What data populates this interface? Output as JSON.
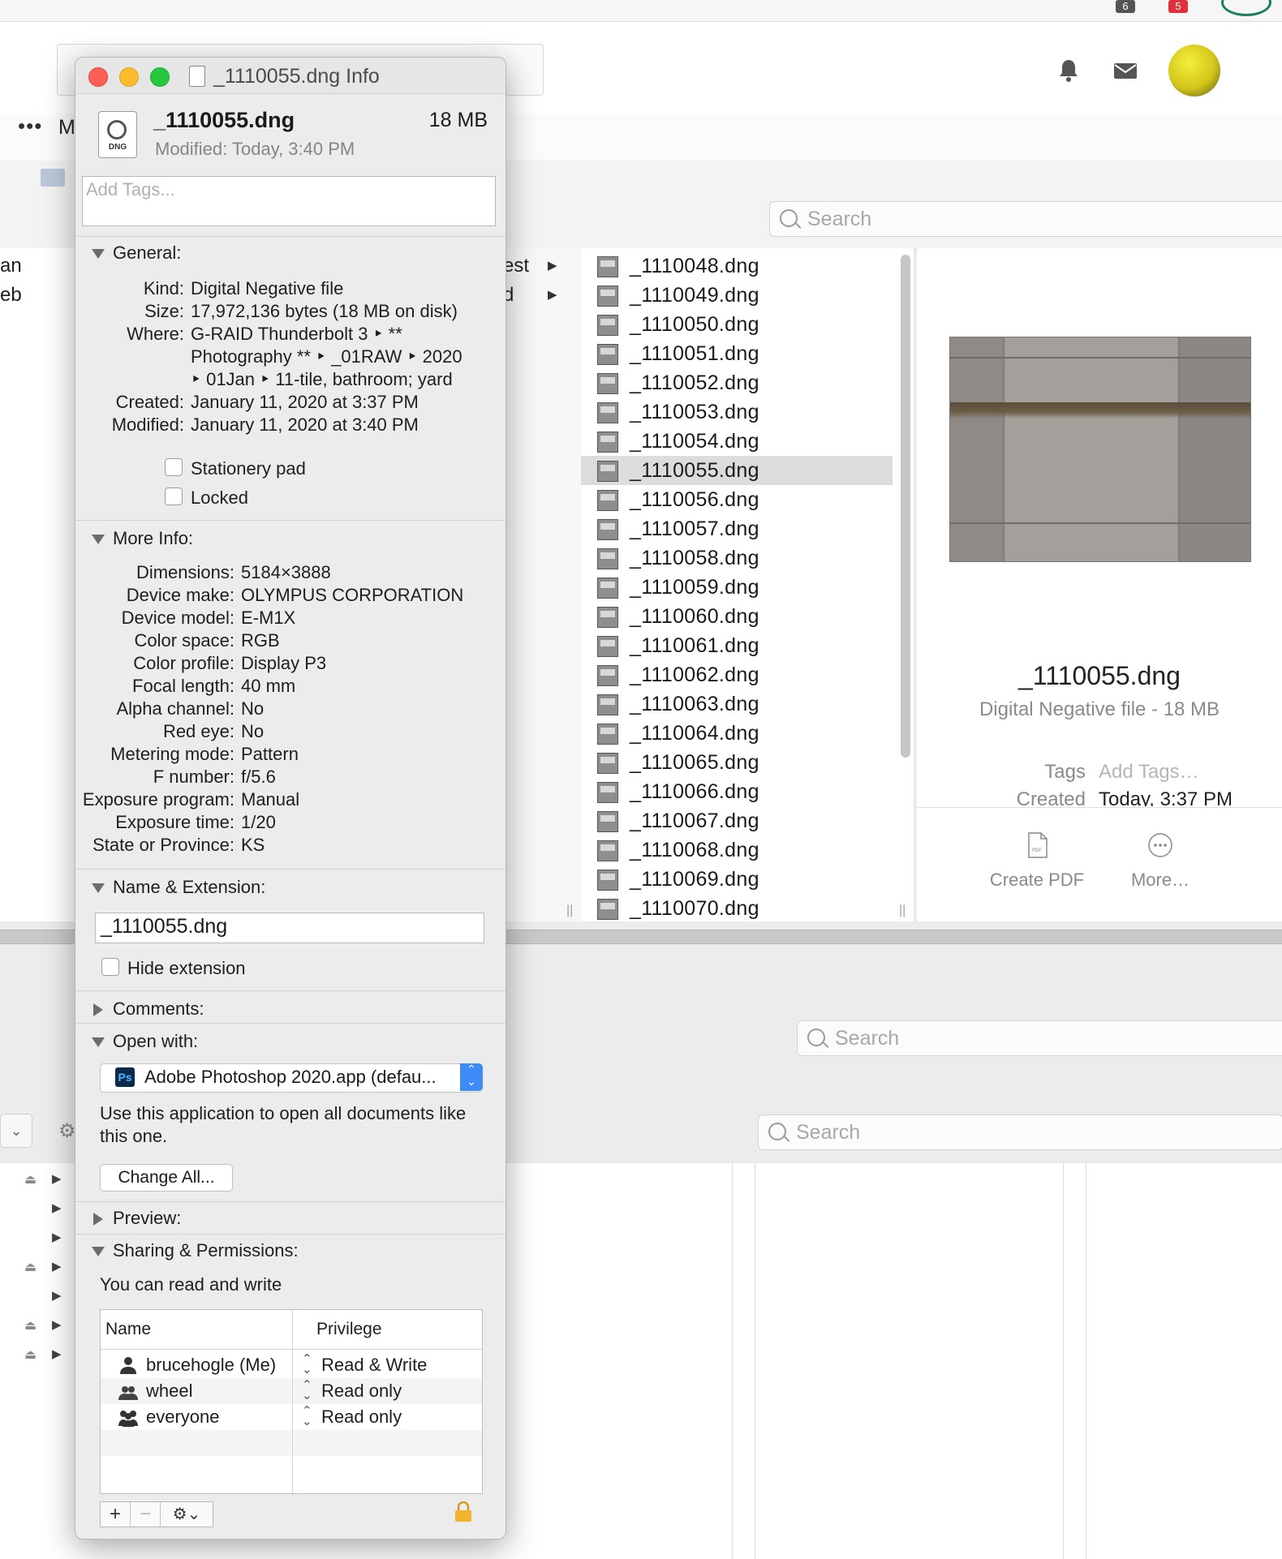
{
  "browser": {
    "badges": [
      "6",
      "5"
    ],
    "nav_letter": "M"
  },
  "finder": {
    "search_placeholder": "Search",
    "left_column": [
      "an",
      "eb"
    ],
    "mid_column": [
      "est",
      "d"
    ],
    "files": [
      "_1110048.dng",
      "_1110049.dng",
      "_1110050.dng",
      "_1110051.dng",
      "_1110052.dng",
      "_1110053.dng",
      "_1110054.dng",
      "_1110055.dng",
      "_1110056.dng",
      "_1110057.dng",
      "_1110058.dng",
      "_1110059.dng",
      "_1110060.dng",
      "_1110061.dng",
      "_1110062.dng",
      "_1110063.dng",
      "_1110064.dng",
      "_1110065.dng",
      "_1110066.dng",
      "_1110067.dng",
      "_1110068.dng",
      "_1110069.dng",
      "_1110070.dng"
    ],
    "selected_file": "_1110055.dng",
    "preview": {
      "name": "_1110055.dng",
      "kind": "Digital Negative file - 18 MB",
      "tags_label": "Tags",
      "tags_placeholder": "Add Tags…",
      "created_label": "Created",
      "created_value": "Today, 3:37 PM",
      "create_pdf": "Create PDF",
      "more": "More…"
    }
  },
  "finder2": {
    "search_placeholder": "Search"
  },
  "finder3": {
    "search_placeholder": "Search"
  },
  "info": {
    "title": "_1110055.dng Info",
    "filename": "_1110055.dng",
    "size": "18 MB",
    "modified_label": "Modified:",
    "modified": "Today, 3:40 PM",
    "icon_label": "DNG",
    "tags_placeholder": "Add Tags...",
    "general": {
      "header": "General:",
      "kind_label": "Kind:",
      "kind": "Digital Negative file",
      "size_label": "Size:",
      "size": "17,972,136 bytes (18 MB on disk)",
      "where_label": "Where:",
      "where_lines": [
        "G-RAID Thunderbolt 3 ‣ **",
        "Photography ** ‣ _01RAW ‣ 2020",
        "‣ 01Jan ‣ 11-tile, bathroom; yard"
      ],
      "created_label": "Created:",
      "created": "January 11, 2020 at 3:37 PM",
      "modified_label": "Modified:",
      "modified": "January 11, 2020 at 3:40 PM",
      "stationery_label": "Stationery pad",
      "locked_label": "Locked"
    },
    "more_info": {
      "header": "More Info:",
      "rows": [
        {
          "label": "Dimensions:",
          "value": "5184×3888"
        },
        {
          "label": "Device make:",
          "value": "OLYMPUS CORPORATION"
        },
        {
          "label": "Device model:",
          "value": "E-M1X"
        },
        {
          "label": "Color space:",
          "value": "RGB"
        },
        {
          "label": "Color profile:",
          "value": "Display P3"
        },
        {
          "label": "Focal length:",
          "value": "40 mm"
        },
        {
          "label": "Alpha channel:",
          "value": "No"
        },
        {
          "label": "Red eye:",
          "value": "No"
        },
        {
          "label": "Metering mode:",
          "value": "Pattern"
        },
        {
          "label": "F number:",
          "value": "f/5.6"
        },
        {
          "label": "Exposure program:",
          "value": "Manual"
        },
        {
          "label": "Exposure time:",
          "value": "1/20"
        },
        {
          "label": "State or Province:",
          "value": "KS"
        }
      ]
    },
    "name_ext": {
      "header": "Name & Extension:",
      "value": "_1110055.dng",
      "hide_ext_label": "Hide extension"
    },
    "comments_header": "Comments:",
    "open_with": {
      "header": "Open with:",
      "app_icon_label": "Ps",
      "app": "Adobe Photoshop 2020.app (defau...",
      "description": "Use this application to open all documents like this one.",
      "change_all": "Change All..."
    },
    "preview_header": "Preview:",
    "sharing": {
      "header": "Sharing & Permissions:",
      "note": "You can read and write",
      "col_name": "Name",
      "col_privilege": "Privilege",
      "rows": [
        {
          "name": "brucehogle (Me)",
          "privilege": "Read & Write"
        },
        {
          "name": "wheel",
          "privilege": "Read only"
        },
        {
          "name": "everyone",
          "privilege": "Read only"
        }
      ]
    }
  }
}
